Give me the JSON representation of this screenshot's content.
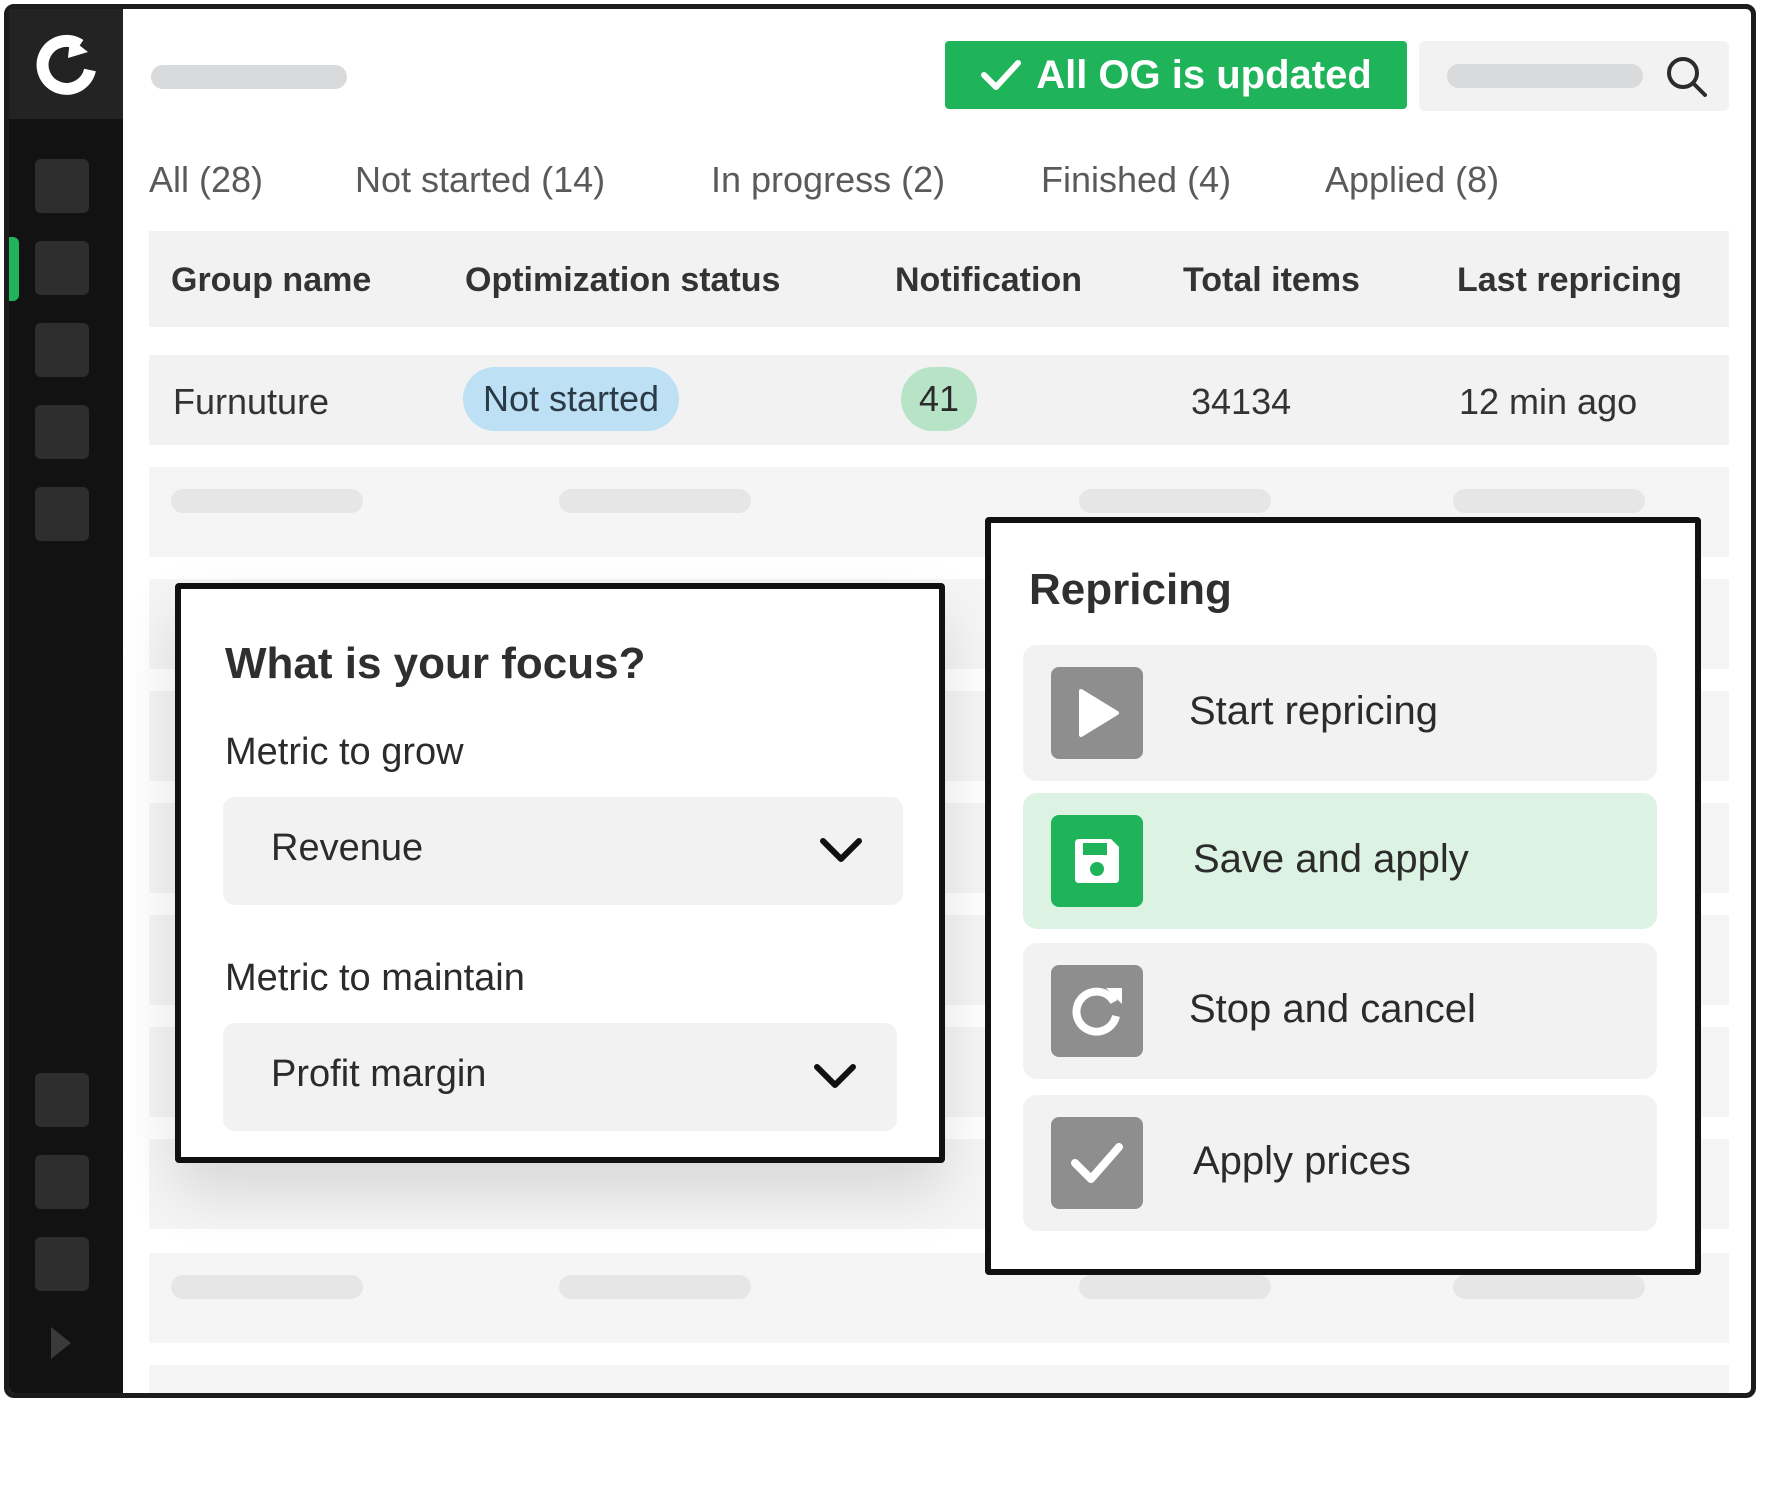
{
  "header": {
    "status_banner": "All OG is updated"
  },
  "tabs": [
    {
      "label": "All (28)"
    },
    {
      "label": "Not started (14)"
    },
    {
      "label": "In progress (2)"
    },
    {
      "label": "Finished (4)"
    },
    {
      "label": "Applied (8)"
    }
  ],
  "table": {
    "columns": [
      "Group name",
      "Optimization status",
      "Notification",
      "Total items",
      "Last repricing"
    ],
    "rows": [
      {
        "group_name": "Furnuture",
        "status": "Not started",
        "notification": "41",
        "total_items": "34134",
        "last_repricing": "12 min ago"
      }
    ]
  },
  "focus_panel": {
    "title": "What is your focus?",
    "grow_label": "Metric to grow",
    "grow_value": "Revenue",
    "maintain_label": "Metric to maintain",
    "maintain_value": "Profit margin"
  },
  "repricing_panel": {
    "title": "Repricing",
    "actions": [
      {
        "label": "Start repricing",
        "icon": "play-icon"
      },
      {
        "label": "Save and apply",
        "icon": "save-icon"
      },
      {
        "label": "Stop and cancel",
        "icon": "refresh-icon"
      },
      {
        "label": "Apply prices",
        "icon": "check-icon"
      }
    ]
  },
  "colors": {
    "accent_green": "#1fb35a",
    "sidebar": "#121212",
    "status_blue": "#bde0f4",
    "notification_green": "#b7e3c7",
    "active_action": "#dcf3e4"
  }
}
